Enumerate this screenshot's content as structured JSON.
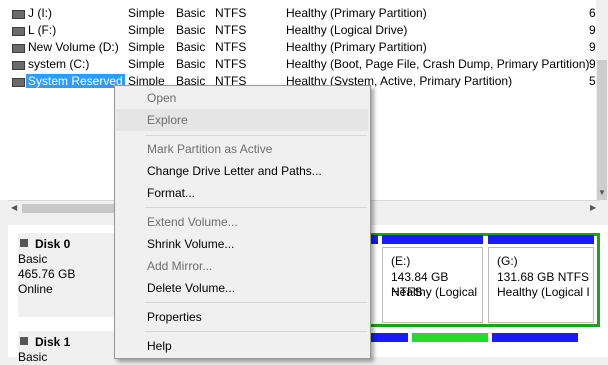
{
  "volumes": [
    {
      "name": "J (I:)",
      "layout": "Simple",
      "type": "Basic",
      "fs": "NTFS",
      "status": "Healthy (Primary Partition)",
      "cap": "6"
    },
    {
      "name": "L (F:)",
      "layout": "Simple",
      "type": "Basic",
      "fs": "NTFS",
      "status": "Healthy (Logical Drive)",
      "cap": "9"
    },
    {
      "name": "New Volume (D:)",
      "layout": "Simple",
      "type": "Basic",
      "fs": "NTFS",
      "status": "Healthy (Primary Partition)",
      "cap": "9"
    },
    {
      "name": "system (C:)",
      "layout": "Simple",
      "type": "Basic",
      "fs": "NTFS",
      "status": "Healthy (Boot, Page File, Crash Dump, Primary Partition)",
      "cap": "9"
    },
    {
      "name": "System Reserved",
      "layout": "Simple",
      "type": "Basic",
      "fs": "NTFS",
      "status": "Healthy (System, Active, Primary Partition)",
      "cap": "5"
    }
  ],
  "disks": [
    {
      "name": "Disk 0",
      "type": "Basic",
      "size": "465.76 GB",
      "state": "Online",
      "partitions": [
        {
          "name": "(E:)",
          "size": "143.84 GB NTFS",
          "status": "Healthy (Logical"
        },
        {
          "name": "(G:)",
          "size": "131.68 GB NTFS",
          "status": "Healthy (Logical I"
        }
      ]
    },
    {
      "name": "Disk 1",
      "type": "Basic"
    }
  ],
  "context_menu": {
    "items": [
      {
        "label": "Open",
        "disabled": true
      },
      {
        "label": "Explore",
        "disabled": true,
        "highlighted": true
      },
      {
        "label": "Mark Partition as Active",
        "disabled": true
      },
      {
        "label": "Change Drive Letter and Paths...",
        "disabled": false
      },
      {
        "label": "Format...",
        "disabled": false
      },
      {
        "label": "Extend Volume...",
        "disabled": true
      },
      {
        "label": "Shrink Volume...",
        "disabled": false
      },
      {
        "label": "Add Mirror...",
        "disabled": true
      },
      {
        "label": "Delete Volume...",
        "disabled": false
      },
      {
        "label": "Properties",
        "disabled": false
      },
      {
        "label": "Help",
        "disabled": false
      }
    ]
  },
  "colors": {
    "primary_partition": "#1a1aff",
    "logical_drive": "#1f9e1f",
    "free_space": "#22dd22",
    "selection": "#3399ff"
  }
}
